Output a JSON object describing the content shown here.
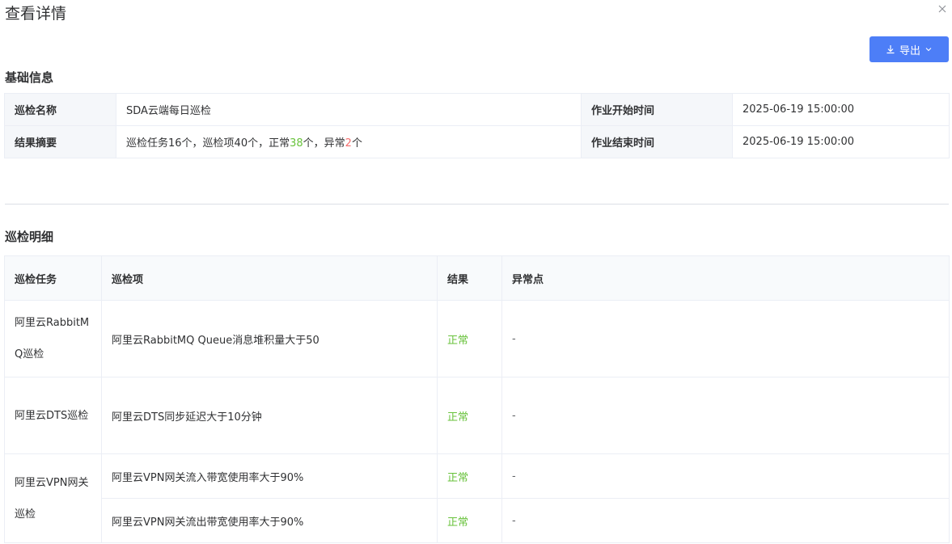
{
  "dialog": {
    "title": "查看详情",
    "export_label": "导出"
  },
  "basic_info": {
    "section_title": "基础信息",
    "rows": [
      {
        "label1": "巡检名称",
        "value1": "SDA云端每日巡检",
        "label2": "作业开始时间",
        "value2": "2025-06-19 15:00:00"
      },
      {
        "label1": "结果摘要",
        "summary": {
          "part1": "巡检任务16个，巡检项40个，正常",
          "ok_count": "38",
          "part2": "个，异常",
          "err_count": "2",
          "part3": "个"
        },
        "label2": "作业结束时间",
        "value2": "2025-06-19 15:00:00"
      }
    ]
  },
  "detail": {
    "section_title": "巡检明细",
    "headers": [
      "巡检任务",
      "巡检项",
      "结果",
      "异常点"
    ],
    "rows": [
      {
        "task": "阿里云RabbitMQ巡检",
        "item": "阿里云RabbitMQ Queue消息堆积量大于50",
        "result": "正常",
        "anomaly": "-"
      },
      {
        "task": "阿里云DTS巡检",
        "item": "阿里云DTS同步延迟大于10分钟",
        "result": "正常",
        "anomaly": "-"
      },
      {
        "task": "阿里云VPN网关巡检",
        "item": "阿里云VPN网关流入带宽使用率大于90%",
        "result": "正常",
        "anomaly": "-"
      },
      {
        "task": "",
        "item": "阿里云VPN网关流出带宽使用率大于90%",
        "result": "正常",
        "anomaly": "-"
      }
    ]
  },
  "colors": {
    "primary": "#4d7ef7",
    "success": "#67c23a",
    "danger": "#f56c6c",
    "border": "#ebeef5",
    "label_bg": "#f5f7fa"
  },
  "icons": {
    "close": "close-icon",
    "download": "download-icon",
    "dropdown": "chevron-down-icon"
  }
}
